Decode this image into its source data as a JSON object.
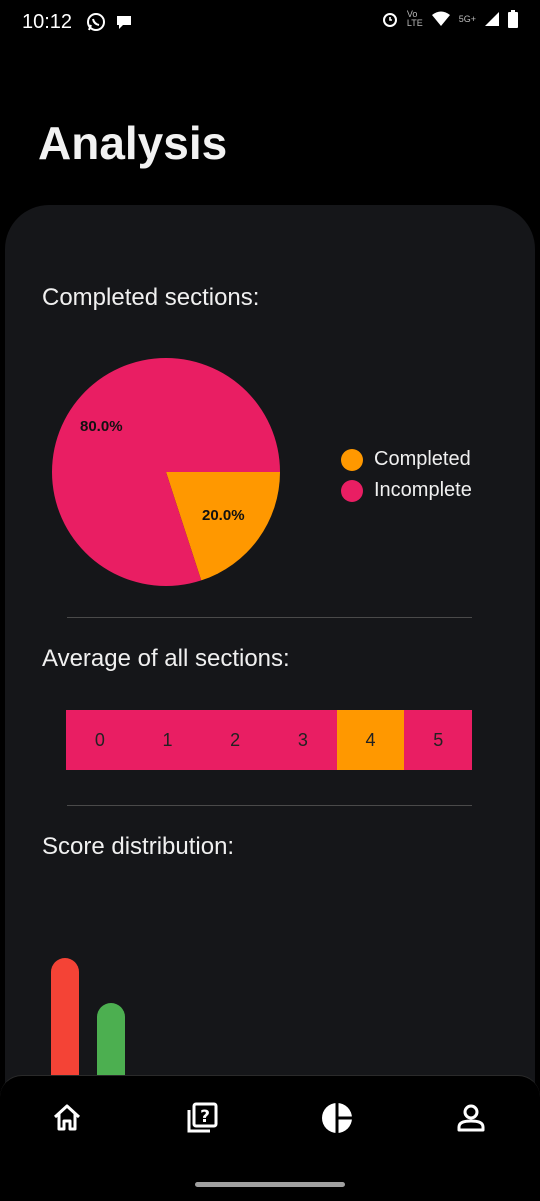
{
  "status_bar": {
    "time": "10:12",
    "network_label": "5G+",
    "lte_label": "LTE",
    "carrier_label": "Vo"
  },
  "page": {
    "title": "Analysis"
  },
  "completed_sections": {
    "title": "Completed sections:",
    "chart_data": {
      "type": "pie",
      "slices": [
        {
          "name": "Completed",
          "value": 20.0,
          "label": "20.0%",
          "color": "#FF9800"
        },
        {
          "name": "Incomplete",
          "value": 80.0,
          "label": "80.0%",
          "color": "#E91E63"
        }
      ],
      "legend": [
        "Completed",
        "Incomplete"
      ],
      "legend_position": "right"
    }
  },
  "average": {
    "title": "Average of all sections:",
    "scale": [
      "0",
      "1",
      "2",
      "3",
      "4",
      "5"
    ],
    "selected_index": 4,
    "colors": {
      "default": "#E91E63",
      "selected": "#FF9800"
    }
  },
  "distribution": {
    "title": "Score distribution:",
    "chart_data": {
      "type": "bar",
      "values": [
        1.0,
        0.62
      ],
      "colors": [
        "#F44336",
        "#4CAF50"
      ]
    }
  },
  "bottom_nav": {
    "items": [
      {
        "name": "home",
        "icon": "home-icon"
      },
      {
        "name": "quiz",
        "icon": "question-cards-icon"
      },
      {
        "name": "analysis",
        "icon": "pie-chart-icon"
      },
      {
        "name": "profile",
        "icon": "person-icon"
      }
    ]
  }
}
